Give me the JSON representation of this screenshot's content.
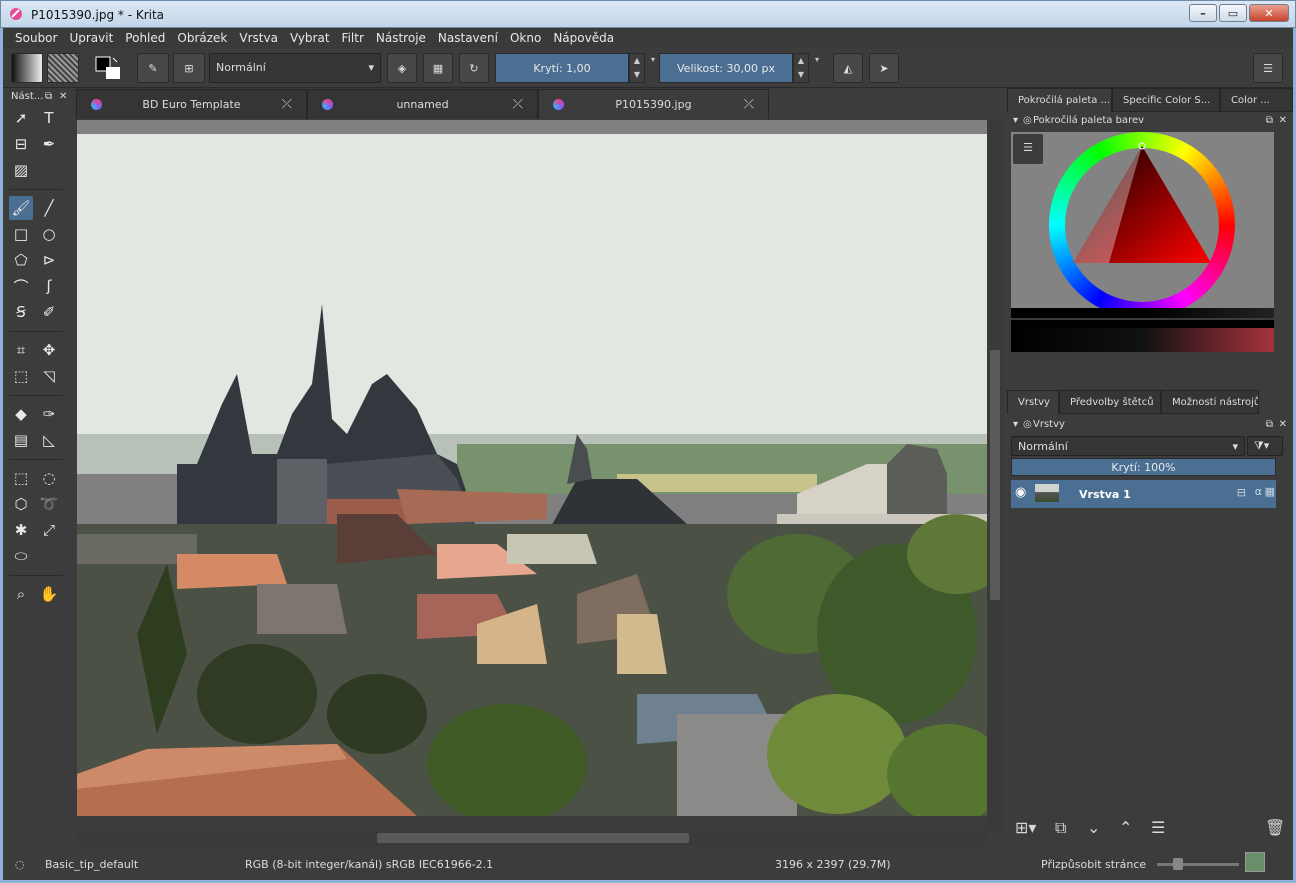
{
  "window": {
    "title": "P1015390.jpg * - Krita"
  },
  "menu": [
    "Soubor",
    "Upravit",
    "Pohled",
    "Obrázek",
    "Vrstva",
    "Vybrat",
    "Filtr",
    "Nástroje",
    "Nastavení",
    "Okno",
    "Nápověda"
  ],
  "toolbar": {
    "blend_mode": "Normální",
    "opacity": "Krytí:  1,00",
    "size_label": "Velikost:",
    "size_value": "30,00 px"
  },
  "toolbox": {
    "title": "Nást..."
  },
  "documents": [
    {
      "name": "BD Euro Template"
    },
    {
      "name": "unnamed"
    },
    {
      "name": "P1015390.jpg",
      "active": true
    }
  ],
  "dockers": {
    "tabs": [
      "Pokročilá paleta ...",
      "Specific Color S...",
      "Color ..."
    ],
    "color_title": "Pokročilá paleta barev",
    "layer_tabs": [
      "Vrstvy",
      "Předvolby štětců",
      "Možnosti nástrojů"
    ],
    "layers_title": "Vrstvy",
    "layer_blend": "Normální",
    "layer_opacity": "Krytí:  100%",
    "layers": [
      {
        "name": "Vrstva 1"
      }
    ]
  },
  "status": {
    "brush": "Basic_tip_default",
    "colorspace": "RGB (8-bit integer/kanál)  sRGB IEC61966-2.1",
    "dimensions": "3196 x 2397 (29.7M)",
    "zoom": "Přizpůsobit stránce"
  },
  "colors": {
    "accent": "#4b6f92",
    "panel": "#3c3c3c"
  }
}
